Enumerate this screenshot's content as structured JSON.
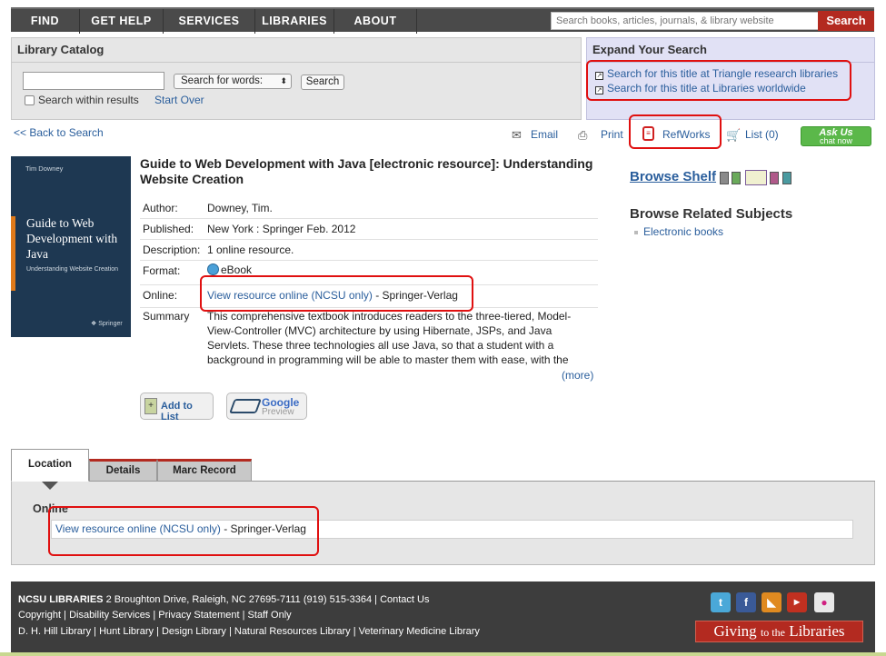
{
  "nav": {
    "items": [
      "FIND",
      "GET HELP",
      "SERVICES",
      "LIBRARIES",
      "ABOUT"
    ],
    "search_placeholder": "Search books, articles, journals, & library website",
    "search_button": "Search"
  },
  "catalog": {
    "title": "Library Catalog",
    "select_value": "Search for words:",
    "search_button": "Search",
    "within_label": "Search within results",
    "start_over": "Start Over"
  },
  "expand": {
    "title": "Expand Your Search",
    "links": [
      "Search for this title at Triangle research libraries",
      "Search for this title at Libraries worldwide"
    ]
  },
  "toolbar": {
    "back": "<< Back to Search",
    "email": "Email",
    "print": "Print",
    "refworks": "RefWorks",
    "list": "List (0)",
    "ask_us": "Ask Us",
    "chat_now": "chat now"
  },
  "cover": {
    "author": "Tim Downey",
    "title": "Guide to Web Development with Java",
    "subtitle": "Understanding Website Creation",
    "publisher": "Springer"
  },
  "record": {
    "title": "Guide to Web Development with Java [electronic resource]: Understanding Website Creation",
    "author_label": "Author:",
    "author": "Downey, Tim.",
    "published_label": "Published:",
    "published": "New York : Springer Feb. 2012",
    "description_label": "Description:",
    "description": "1 online resource.",
    "format_label": "Format:",
    "format": "eBook",
    "online_label": "Online:",
    "online_link": "View resource online (NCSU only)",
    "online_suffix": "- Springer-Verlag",
    "summary_label": "Summary",
    "summary": "This comprehensive textbook introduces readers to the three-tiered, Model-View-Controller (MVC) architecture by using Hibernate, JSPs, and Java Servlets. These three technologies all use Java, so that a student with a background in programming will be able to master them with ease, with the",
    "more": "(more)",
    "add_to_list": "Add to List",
    "google": "Google",
    "preview": "Preview"
  },
  "sidebar": {
    "browse_shelf": "Browse Shelf",
    "related_title": "Browse Related Subjects",
    "related_items": [
      "Electronic books"
    ]
  },
  "tabs": {
    "items": [
      "Location",
      "Details",
      "Marc Record"
    ],
    "online_heading": "Online",
    "online_link": "View resource online (NCSU only)",
    "online_suffix": "- Springer-Verlag"
  },
  "footer": {
    "org": "NCSU LIBRARIES",
    "address": "2 Broughton Drive, Raleigh, NC 27695-7111 (919) 515-3364 |",
    "contact": "Contact Us",
    "line2": [
      "Copyright",
      "Disability Services",
      "Privacy Statement",
      "Staff Only"
    ],
    "line3": [
      "D. H. Hill Library",
      "Hunt Library",
      "Design Library",
      "Natural Resources Library",
      "Veterinary Medicine Library"
    ],
    "giving_a": "Giving",
    "giving_b": "to the",
    "giving_c": "Libraries"
  },
  "colors": {
    "nav_bg": "#4a4a4a",
    "brand_red": "#b32a20",
    "link": "#2a5e9c",
    "ask_green": "#5bb84a",
    "highlight_red": "#e01010"
  }
}
